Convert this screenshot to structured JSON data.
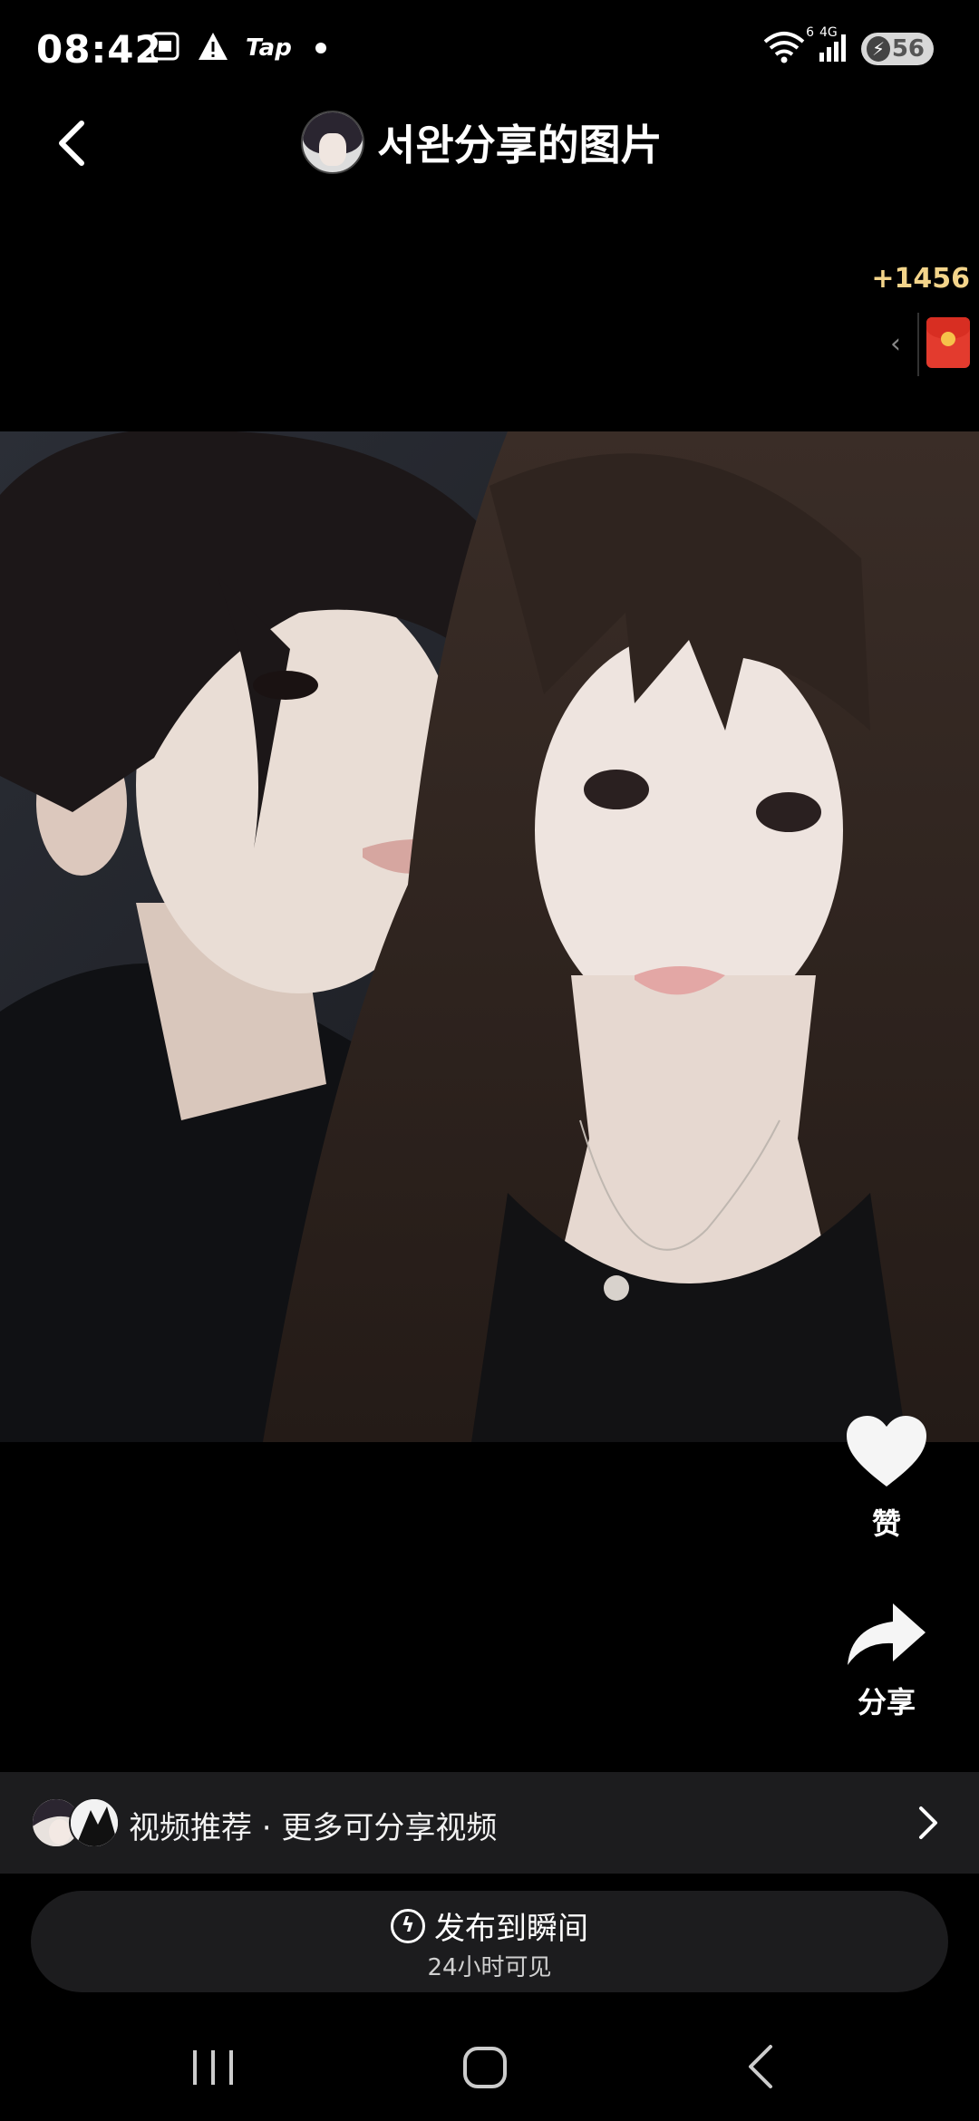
{
  "status_bar": {
    "time": "08:42",
    "tap_label": "Tap",
    "network_label": "4G",
    "wifi_label": "6",
    "battery": "56",
    "icons": [
      "screenshot-icon",
      "warning-icon",
      "wifi-icon",
      "signal-icon",
      "battery-icon"
    ]
  },
  "header": {
    "title": "서완分享的图片",
    "back_icon": "chevron-left-icon"
  },
  "reward": {
    "count": "+1456",
    "icon": "red-packet-icon"
  },
  "actions": {
    "like_label": "赞",
    "share_label": "分享"
  },
  "recommendation": {
    "text": "视频推荐 · 更多可分享视频"
  },
  "publish": {
    "label": "发布到瞬间",
    "sublabel": "24小时可见"
  },
  "colors": {
    "background": "#000000",
    "panel": "#1c1c1e",
    "reward_text": "#f3d48a",
    "red_packet": "#e33b2e"
  }
}
